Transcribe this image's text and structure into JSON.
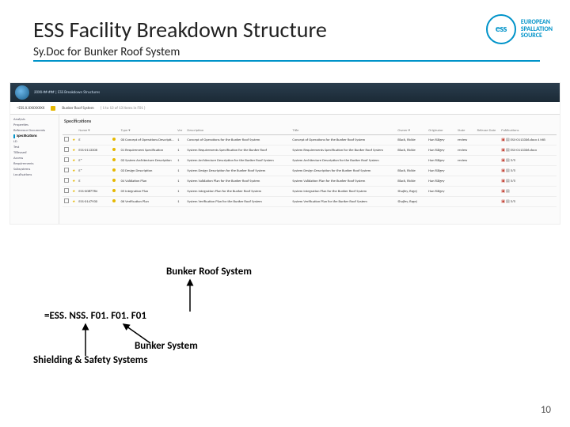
{
  "header": {
    "title": "ESS Facility Breakdown Structure",
    "subtitle": "Sy.Doc for Bunker Roof System"
  },
  "logo": {
    "mark": "ess",
    "l1": "EUROPEAN",
    "l2": "SPALLATION",
    "l3": "SOURCE"
  },
  "screenshot": {
    "breadcrumb": "20XX-##-### |  ESS Breakdown Structures",
    "path_label": "=ESS.X.XXXXXXXX",
    "node_label": "Bunker Roof System",
    "node_hint": "( 1 to 13 of 13 items in F01 )",
    "side_items": [
      "Analysis",
      "Properties",
      "Reference Documents",
      "Specifications",
      "LD",
      "Test",
      "TBleased",
      "Access",
      "Requirements",
      "Subsystems",
      "Localisations",
      ""
    ],
    "side_selected_index": 3,
    "section_title": "Specifications",
    "columns": [
      " ",
      "",
      "Name ▾",
      "",
      "Type ▾",
      "Ver",
      "Description",
      "Title",
      "Owner ▾",
      "Originator",
      "State",
      "Release Date",
      "Publications"
    ],
    "rows": [
      {
        "name": "E",
        "t": "00",
        "type": "Concept of Operations Description",
        "ver": "1",
        "desc": "Concept of Operations for the Bunker Roof System",
        "title": "Concept of Operations for the Bunker Roof System",
        "owner": "Black, Rickie",
        "orig": "Han Rålgey",
        "state": "review",
        "pub": "ESS-0113306.docx 4 MB"
      },
      {
        "name": "ESS-0113306",
        "t": "01",
        "type": "Requirement Specification",
        "ver": "1",
        "desc": "System Requirements Specification for the Bunker Roof",
        "title": "System Requirements Specification for the Bunker Roof System",
        "owner": "Black, Rickie",
        "orig": "Han Rålgey",
        "state": "review",
        "pub": "ESS-0113306.docx"
      },
      {
        "name": "E*",
        "t": "02",
        "type": "System Architecture Description",
        "ver": "1",
        "desc": "System Architecture Description for the Bunker Roof System",
        "title": "System Architecture Description for the Bunker Roof System",
        "owner": "",
        "orig": "Han Rålgey",
        "state": "review",
        "pub": "5/5"
      },
      {
        "name": "E*",
        "t": "03",
        "type": "Design Description",
        "ver": "1",
        "desc": "System Design Description for the Bunker Roof System",
        "title": "System Design Description for the Bunker Roof System",
        "owner": "Black, Rickie",
        "orig": "Han Rålgey",
        "state": "",
        "pub": "5/5"
      },
      {
        "name": "E",
        "t": "04",
        "type": "Validation Plan",
        "ver": "1",
        "desc": "System Validation Plan for the Bunker Roof System",
        "title": "System Validation Plan for the Bunker Roof System",
        "owner": "Black, Rickie",
        "orig": "Han Rålgey",
        "state": "",
        "pub": "5/5"
      },
      {
        "name": "ESS-0087784",
        "t": "05",
        "type": "Integration Plan",
        "ver": "1",
        "desc": "System Integration Plan for the Bunker Roof System",
        "title": "System Integration Plan for the Bunker Roof System",
        "owner": "Shajley, Rzgej",
        "orig": "Han Rålgey",
        "state": "",
        "pub": ""
      },
      {
        "name": "ESS-0147930",
        "t": "06",
        "type": "Verification Plan",
        "ver": "1",
        "desc": "System Verification Plan for the Bunker Roof System",
        "title": "System Verification Plan for the Bunker Roof System",
        "owner": "Shajley, Rzgej",
        "orig": "",
        "state": "",
        "pub": "5/5"
      }
    ]
  },
  "annotations": {
    "bunker_roof": "Bunker Roof System",
    "code": "=ESS. NSS. F01. F01. F01",
    "bunker_system": "Bunker System",
    "shielding": "Shielding & Safety Systems"
  },
  "page_number": "10"
}
